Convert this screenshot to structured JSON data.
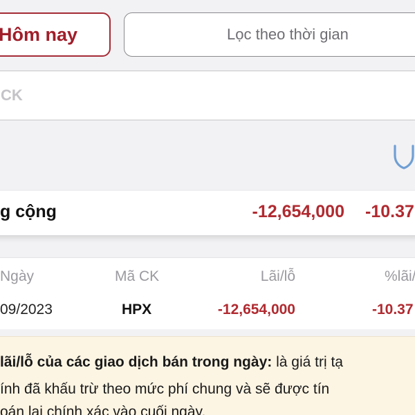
{
  "filters": {
    "today_label": "Hôm nay",
    "time_filter_label": "Lọc theo thời gian"
  },
  "search": {
    "placeholder": "CK"
  },
  "icons": {
    "shield": "shield-icon"
  },
  "summary": {
    "label": "g cộng",
    "value": "-12,654,000",
    "percent": "-10.37"
  },
  "table": {
    "headers": {
      "date": "Ngày",
      "code": "Mã CK",
      "profit_loss": "Lãi/lỗ",
      "percent": "%lãi/"
    },
    "rows": [
      {
        "date": "09/2023",
        "code": "HPX",
        "profit_loss": "-12,654,000",
        "percent": "-10.37"
      }
    ]
  },
  "note": {
    "term": "lãi/lỗ của các giao dịch bán trong ngày:",
    "line1_rest": " là giá trị tạ",
    "line2": "ính đã khấu trừ theo mức phí chung và sẽ được tín",
    "line3": "oán lại chính xác vào cuối ngày."
  },
  "colors": {
    "accent": "#a01e2a",
    "negative": "#b02a30",
    "background": "#f2f2f4",
    "note_background": "#fdf5e4"
  }
}
